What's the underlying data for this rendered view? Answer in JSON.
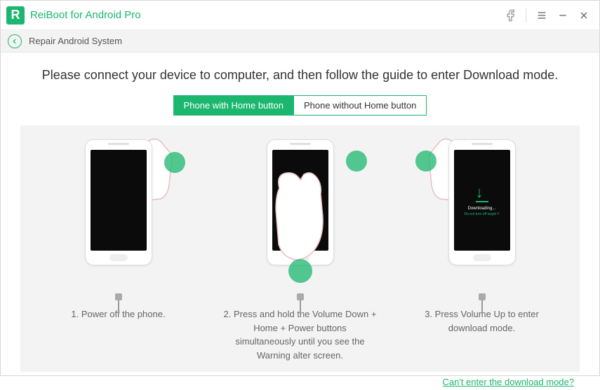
{
  "titlebar": {
    "app_name": "ReiBoot for Android Pro"
  },
  "subbar": {
    "title": "Repair Android System"
  },
  "content": {
    "headline": "Please connect your device to computer, and then follow the guide to enter Download mode.",
    "tabs": {
      "home": "Phone with Home button",
      "nohome": "Phone without Home button"
    },
    "steps": {
      "s1": "1. Power off the phone.",
      "s2": "2. Press and hold the Volume Down + Home + Power buttons simultaneously until you see the Warning alter screen.",
      "s3": "3. Press Volume Up to enter download mode."
    },
    "downloading": {
      "label": "Downloading...",
      "warn": "Do not turn off target !!"
    },
    "footer_link": "Can't enter the download mode?"
  }
}
